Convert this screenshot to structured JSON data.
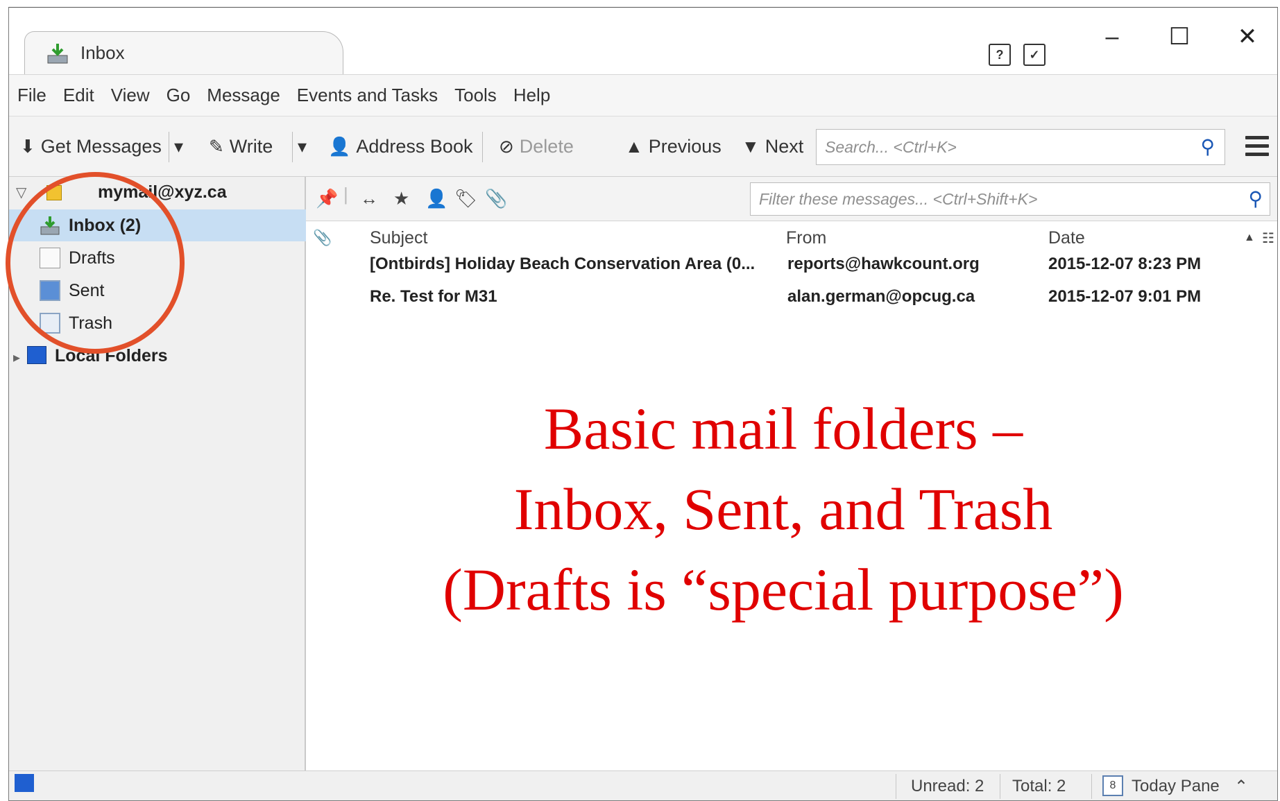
{
  "tab": {
    "title": "Inbox"
  },
  "window_controls": {
    "minimize": "–",
    "maximize": "☐",
    "close": "✕"
  },
  "menu": [
    {
      "label": "File"
    },
    {
      "label": "Edit"
    },
    {
      "label": "View"
    },
    {
      "label": "Go"
    },
    {
      "label": "Message"
    },
    {
      "label": "Events and Tasks"
    },
    {
      "label": "Tools"
    },
    {
      "label": "Help"
    }
  ],
  "toolbar": {
    "get_messages": "Get Messages",
    "write": "Write",
    "address_book": "Address Book",
    "delete": "Delete",
    "previous": "Previous",
    "next": "Next",
    "search_placeholder": "Search... <Ctrl+K>"
  },
  "folders": {
    "account": "mymail@xyz.ca",
    "items": [
      {
        "label": "Inbox (2)",
        "icon": "inbox-icon"
      },
      {
        "label": "Drafts",
        "icon": "drafts-icon"
      },
      {
        "label": "Sent",
        "icon": "sent-icon"
      },
      {
        "label": "Trash",
        "icon": "trash-icon"
      }
    ],
    "local": "Local Folders"
  },
  "filter": {
    "placeholder": "Filter these messages... <Ctrl+Shift+K>"
  },
  "columns": {
    "subject": "Subject",
    "from": "From",
    "date": "Date"
  },
  "messages": [
    {
      "subject": "[Ontbirds] Holiday Beach Conservation Area (0...",
      "from": "reports@hawkcount.org",
      "date": "2015-12-07 8:23 PM"
    },
    {
      "subject": "Re. Test for M31",
      "from": "alan.german@opcug.ca",
      "date": "2015-12-07 9:01 PM"
    }
  ],
  "annotation": {
    "line1": "Basic mail folders –",
    "line2": "Inbox, Sent, and Trash",
    "line3": "(Drafts is “special purpose”)"
  },
  "status": {
    "unread": "Unread: 2",
    "total": "Total: 2",
    "today_pane": "Today Pane",
    "calendar_day": "8"
  },
  "colors": {
    "selection": "#c7def3",
    "annotation": "#e00000",
    "circle": "#e2502a"
  }
}
